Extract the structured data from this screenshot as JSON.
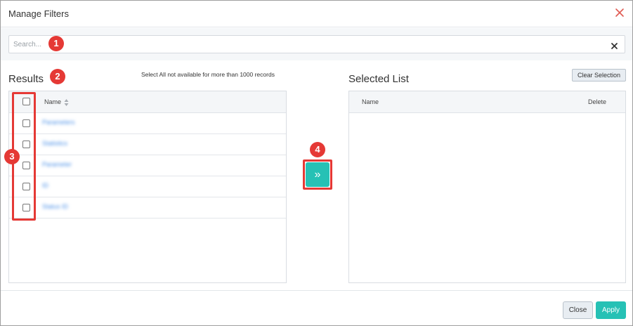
{
  "dialog": {
    "title": "Manage Filters",
    "close_icon": "close-icon",
    "accent_color": "#26c1b5",
    "annotation_color": "#e53935"
  },
  "search": {
    "placeholder": "Search...",
    "value": "",
    "clear_icon": "clear-icon"
  },
  "annotations": [
    "1",
    "2",
    "3",
    "4"
  ],
  "results": {
    "label": "Results",
    "note": "Select All not available for more than 1000 records",
    "columns": [
      "Name"
    ],
    "sort_icon": "sort-icon",
    "rows": [
      {
        "name": "Parameters"
      },
      {
        "name": "Statistics"
      },
      {
        "name": "Parameter"
      },
      {
        "name": "ID"
      },
      {
        "name": "Status ID"
      }
    ]
  },
  "move": {
    "label": "»",
    "icon": "double-chevron-right-icon"
  },
  "selected": {
    "label": "Selected List",
    "clear_label": "Clear Selection",
    "columns": [
      "Name",
      "Delete"
    ],
    "rows": []
  },
  "footer": {
    "close_label": "Close",
    "apply_label": "Apply"
  }
}
